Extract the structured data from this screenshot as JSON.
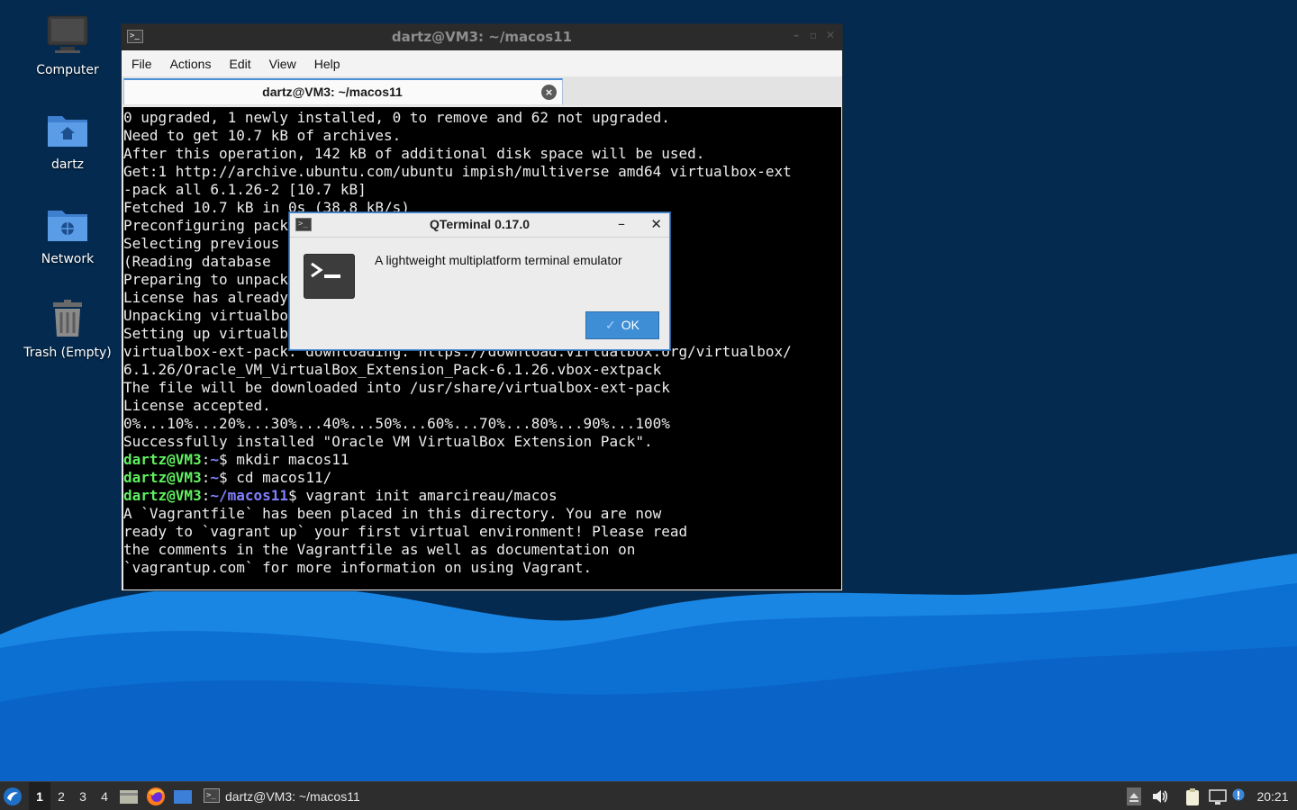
{
  "desktop": {
    "icons": [
      {
        "label": "Computer",
        "icon": "computer-icon"
      },
      {
        "label": "dartz",
        "icon": "home-folder-icon"
      },
      {
        "label": "Network",
        "icon": "network-folder-icon"
      },
      {
        "label": "Trash (Empty)",
        "icon": "trash-icon"
      }
    ]
  },
  "terminal": {
    "title": "dartz@VM3: ~/macos11",
    "menu": [
      "File",
      "Actions",
      "Edit",
      "View",
      "Help"
    ],
    "tab_label": "dartz@VM3: ~/macos11",
    "lines": [
      "0 upgraded, 1 newly installed, 0 to remove and 62 not upgraded.",
      "Need to get 10.7 kB of archives.",
      "After this operation, 142 kB of additional disk space will be used.",
      "Get:1 http://archive.ubuntu.com/ubuntu impish/multiverse amd64 virtualbox-ext",
      "-pack all 6.1.26-2 [10.7 kB]",
      "Fetched 10.7 kB in 0s (38.8 kB/s)",
      "Preconfiguring pack",
      "Selecting previous",
      "(Reading database                     installed.)",
      "Preparing to unpack                   ...",
      "License has already",
      "Unpacking virtualbo",
      "Setting up virtualb",
      "virtualbox-ext-pack: downloading: https://download.virtualbox.org/virtualbox/",
      "6.1.26/Oracle_VM_VirtualBox_Extension_Pack-6.1.26.vbox-extpack",
      "The file will be downloaded into /usr/share/virtualbox-ext-pack",
      "License accepted.",
      "0%...10%...20%...30%...40%...50%...60%...70%...80%...90%...100%",
      "Successfully installed \"Oracle VM VirtualBox Extension Pack\"."
    ],
    "prompts": [
      {
        "user": "dartz@VM3",
        "sep": ":",
        "path": "~",
        "sym": "$ ",
        "cmd": "mkdir macos11"
      },
      {
        "user": "dartz@VM3",
        "sep": ":",
        "path": "~",
        "sym": "$ ",
        "cmd": "cd macos11/"
      },
      {
        "user": "dartz@VM3",
        "sep": ":",
        "path": "~/macos11",
        "sym": "$ ",
        "cmd": "vagrant init amarcireau/macos"
      }
    ],
    "tail": [
      "A `Vagrantfile` has been placed in this directory. You are now",
      "ready to `vagrant up` your first virtual environment! Please read",
      "the comments in the Vagrantfile as well as documentation on",
      "`vagrantup.com` for more information on using Vagrant."
    ]
  },
  "dialog": {
    "title": "QTerminal 0.17.0",
    "message": "A lightweight multiplatform terminal emulator",
    "ok_label": "OK"
  },
  "taskbar": {
    "workspaces": [
      "1",
      "2",
      "3",
      "4"
    ],
    "active_task": "dartz@VM3: ~/macos11",
    "clock": "20:21"
  },
  "colors": {
    "wallpaper_dark": "#042a4f",
    "wave_light": "#1f8fe8",
    "wave_mid": "#0a6fd0",
    "prompt_user": "#5ff05f",
    "prompt_path": "#8080ff",
    "accent": "#3e8ed6"
  }
}
